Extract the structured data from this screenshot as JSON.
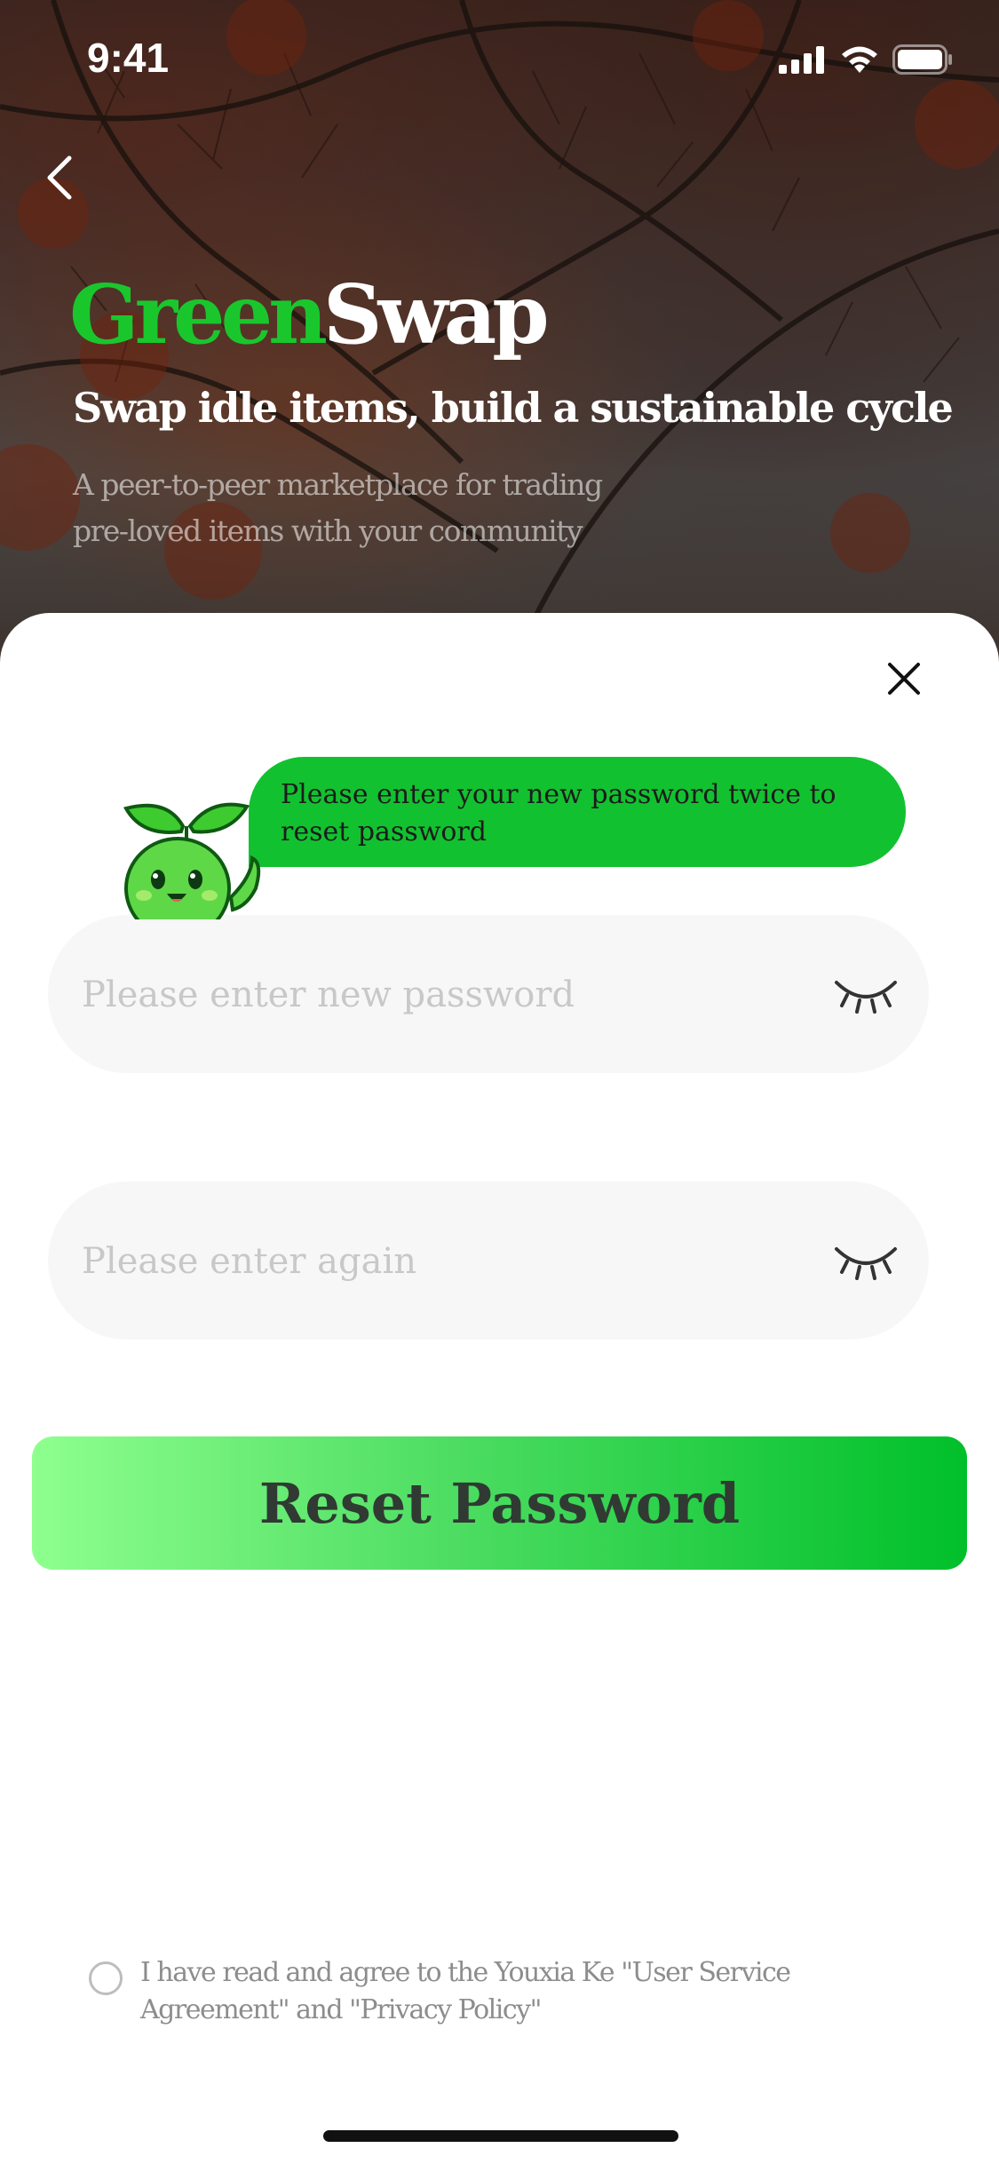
{
  "status_bar": {
    "time": "9:41"
  },
  "header": {
    "brand_green": "Green",
    "brand_white": "Swap",
    "tagline": "Swap idle items, build a sustainable cycle",
    "description_line1": "A peer-to-peer marketplace for trading",
    "description_line2": "pre-loved items with your community"
  },
  "dialog": {
    "bubble_text": "Please enter your new password twice to reset password",
    "new_password_placeholder": "Please enter new password",
    "confirm_password_placeholder": "Please enter again",
    "submit_label": "Reset Password"
  },
  "agreement": {
    "text": "I have read and agree to the Youxia Ke \"User Service Agreement\" and \"Privacy Policy\""
  },
  "colors": {
    "accent_green": "#12c130",
    "button_gradient_start": "#8eff8e",
    "button_gradient_end": "#00c02a"
  },
  "icons": [
    "back-chevron-icon",
    "close-icon",
    "eye-closed-icon",
    "signal-icon",
    "wifi-icon",
    "battery-icon",
    "mascot-sprout"
  ]
}
